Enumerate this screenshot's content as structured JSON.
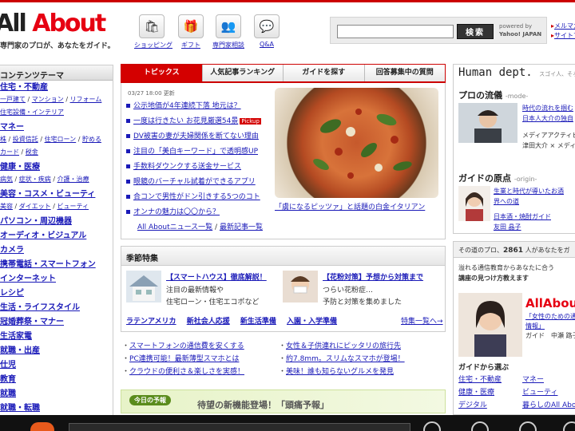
{
  "header": {
    "logo_prefix": "All ",
    "logo_suffix": "About",
    "tagline": "専門家のプロが、あなたをガイド。",
    "nav_icons": [
      {
        "label": "ショッピング",
        "icon": "shopping-bag-icon"
      },
      {
        "label": "ギフト",
        "icon": "gift-icon"
      },
      {
        "label": "専門家相談",
        "icon": "consult-people-icon"
      },
      {
        "label": "Q&A",
        "icon": "qa-bubble-icon"
      }
    ],
    "search": {
      "value": "",
      "button": "検索",
      "powered_by_1": "powered by",
      "powered_by_2": "Yahoo! JAPAN"
    },
    "right_links": [
      "メルマガ",
      "サイトマ"
    ]
  },
  "left": {
    "header": "コンテンツテーマ",
    "categories": [
      {
        "title": "住宅・不動産",
        "subs": [
          [
            "一戸建て",
            "マンション",
            "リフォーム"
          ],
          [
            "住宅設備・インテリア"
          ]
        ]
      },
      {
        "title": "マネー",
        "subs": [
          [
            "株",
            "投資信託",
            "住宅ローン",
            "貯める"
          ],
          [
            "カード",
            "税金"
          ]
        ]
      },
      {
        "title": "健康・医療",
        "subs": [
          [
            "病気",
            "症状・疾病",
            "介護・治療"
          ]
        ]
      },
      {
        "title": "美容・コスメ・ビューティ",
        "subs": [
          [
            "美容",
            "ダイエット",
            "ビューティ"
          ]
        ]
      },
      {
        "title": "パソコン・周辺機器",
        "subs": []
      },
      {
        "title": "オーディオ・ビジュアル",
        "subs": []
      },
      {
        "title": "カメラ",
        "subs": []
      },
      {
        "title": "携帯電話・スマートフォン",
        "subs": []
      },
      {
        "title": "インターネット",
        "subs": []
      },
      {
        "title": "レシピ",
        "subs": []
      },
      {
        "title": "生活・ライフスタイル",
        "subs": []
      },
      {
        "title": "冠婚葬祭・マナー",
        "subs": []
      },
      {
        "title": "生活家電",
        "subs": []
      },
      {
        "title": "就職・出産",
        "subs": []
      },
      {
        "title": "仕児",
        "subs": []
      },
      {
        "title": "教育",
        "subs": []
      },
      {
        "title": "就職",
        "subs": []
      },
      {
        "title": "就職・転職",
        "subs": []
      }
    ]
  },
  "center": {
    "tabs": [
      "トピックス",
      "人気記事ランキング",
      "ガイドを探す",
      "回答募集中の質問"
    ],
    "topics_date": "03/27 18:00 更新",
    "topics": [
      {
        "text": "公示地価が4年連続下落 地元は？",
        "pickup": false
      },
      {
        "text": "一度は行きたい お花見厳選54景",
        "pickup": true
      },
      {
        "text": "DV被害の妻が夫婦関係を断てない理由",
        "pickup": false
      },
      {
        "text": "注目の「美白キーワード」で透明感UP",
        "pickup": false
      },
      {
        "text": "手数料ダウンクする送金サービス",
        "pickup": false
      },
      {
        "text": "眼鏡のバーチャル試着ができるアプリ",
        "pickup": false
      },
      {
        "text": "合コンで男性がドン引きする5つのコト",
        "pickup": false
      },
      {
        "text": "オンナの魅力は〇〇から？",
        "pickup": false
      }
    ],
    "pickup_label": "Pickup",
    "topics_more_1": "All Aboutニュース一覧",
    "topics_more_sep": " / ",
    "topics_more_2": "最新記事一覧",
    "pizza_caption": "「虜になるピッツァ」と話題の白金イタリアン",
    "season": {
      "title": "季節特集",
      "blocks": [
        {
          "title": "【スマートハウス】徹底解説！",
          "desc": [
            "注目の最新情報や",
            "住宅ローン・住宅エコポなど"
          ]
        },
        {
          "title": "【花粉対策】予想から対策まで",
          "desc": [
            "つらい花粉症…",
            "予防と対策を集めました"
          ]
        }
      ],
      "links": [
        "ラテンアメリカ",
        "新社会人応援",
        "新生活準備",
        "入園・入学準備"
      ],
      "more": "特集一覧へ"
    },
    "misc_left": [
      "スマートフォンの通信費を安くする",
      "PC連携可能！最新薄型スマホとは",
      "クラウドの便利さ＆楽しさを実感！"
    ],
    "misc_right": [
      "女性＆子供連れにピッタリの旅行先",
      "約7.8mm。スリムなスマホが登場！",
      "美味！誰も知らないグルメを発見"
    ],
    "banner_today": "今日の予報",
    "banner_text": "待望の新機能登場！「頭痛予報」"
  },
  "right": {
    "hd_title": "Human dept.",
    "hd_sub": "スゴイ人、そろって",
    "sec1_title": "プロの流儀",
    "sec1_sub": "-mode-",
    "sec1_link": [
      "時代の流れを掴む",
      "日本人大介の独自"
    ],
    "sec1_text": [
      "メディアアクティビス",
      "津田大介 × メディア"
    ],
    "sec2_title": "ガイドの原点",
    "sec2_sub": "-origin-",
    "sec2_link": [
      "生業と時代が導いたお酒",
      "界への道"
    ],
    "sec2_text": [
      "日本酒・焼酎ガイド",
      "友田 晶子"
    ],
    "pro_count_pre": "その道のプロ、",
    "pro_count": "2861",
    "pro_count_post": " 人があなたをガ",
    "pro_intro": [
      "溢れる通信教育からあなたに合う",
      "講座の見つけ方教えます"
    ],
    "pro_logo_1": "All",
    "pro_logo_2": "Abou",
    "pro_item": [
      "「女性のための通",
      "情報」",
      "ガイド　中瀬 路子"
    ],
    "pro_from": "ガイドから選ぶ",
    "pro_grid": [
      "住宅・不動産",
      "マネー",
      "健康・医療",
      "ビューティ",
      "デジタル",
      "暮らしのAll Abou"
    ]
  }
}
